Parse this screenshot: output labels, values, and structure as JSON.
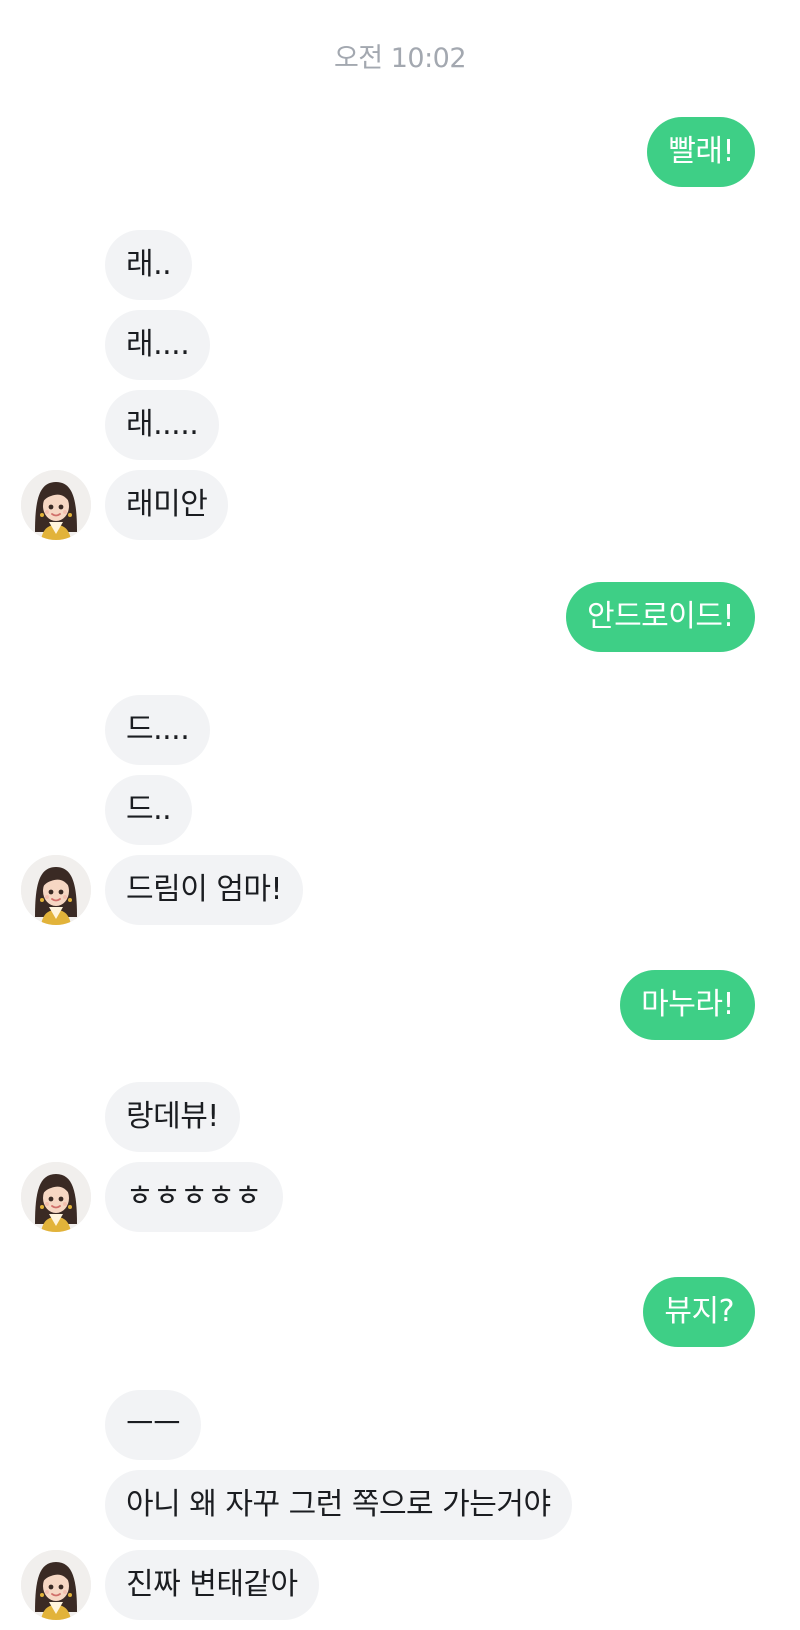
{
  "timestamp": "오전 10:02",
  "colors": {
    "outgoing_bubble": "#3ecf86",
    "incoming_bubble": "#f2f3f5",
    "timestamp_text": "#a3a8b0"
  },
  "partner": {
    "avatar_icon": "girl-avatar-icon"
  },
  "messages": [
    {
      "side": "outgoing",
      "text": "빨래!"
    },
    {
      "side": "incoming",
      "text": "래.."
    },
    {
      "side": "incoming",
      "text": "래...."
    },
    {
      "side": "incoming",
      "text": "래....."
    },
    {
      "side": "incoming",
      "text": "래미안"
    },
    {
      "side": "outgoing",
      "text": "안드로이드!"
    },
    {
      "side": "incoming",
      "text": "드...."
    },
    {
      "side": "incoming",
      "text": "드.."
    },
    {
      "side": "incoming",
      "text": "드림이 엄마!"
    },
    {
      "side": "outgoing",
      "text": "마누라!"
    },
    {
      "side": "incoming",
      "text": "랑데뷰!"
    },
    {
      "side": "incoming",
      "text": "ㅎㅎㅎㅎㅎ"
    },
    {
      "side": "outgoing",
      "text": "뷰지?"
    },
    {
      "side": "incoming",
      "text": "ㅡㅡ"
    },
    {
      "side": "incoming",
      "text": "아니 왜 자꾸 그런 쪽으로 가는거야"
    },
    {
      "side": "incoming",
      "text": "진짜 변태같아"
    }
  ]
}
